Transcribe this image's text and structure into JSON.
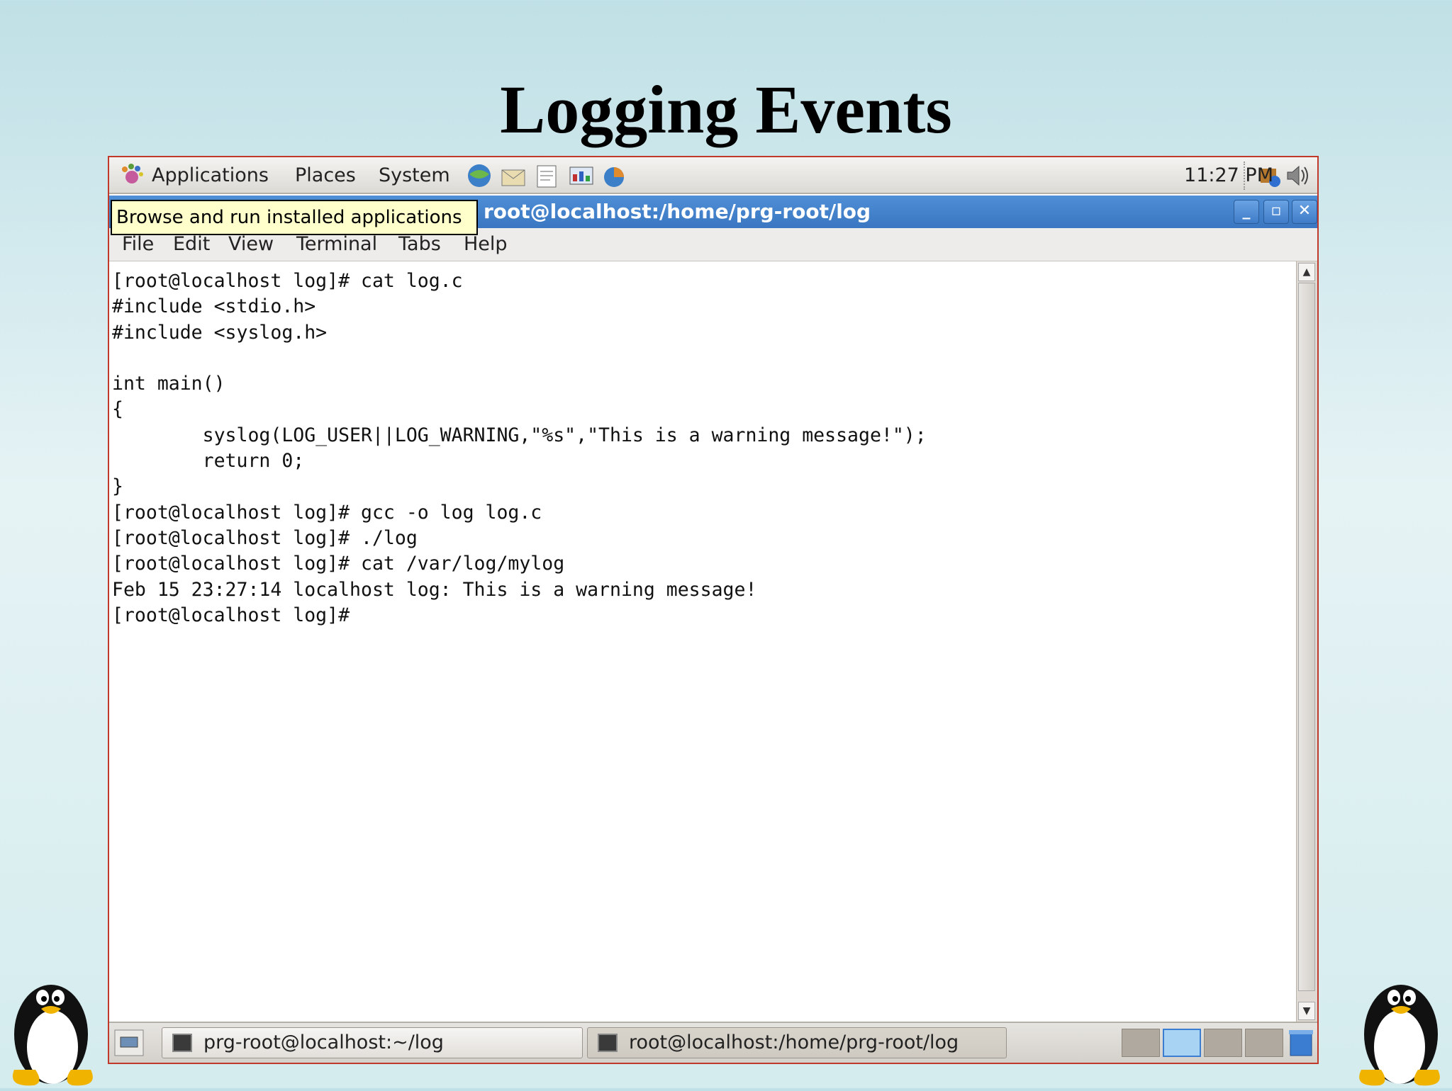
{
  "slide": {
    "title": "Logging Events"
  },
  "top_panel": {
    "menus": [
      "Applications",
      "Places",
      "System"
    ],
    "clock": "11:27 PM"
  },
  "window": {
    "title": "root@localhost:/home/prg-root/log",
    "tooltip": "Browse and run installed applications",
    "menubar": [
      "File",
      "Edit",
      "View",
      "Terminal",
      "Tabs",
      "Help"
    ]
  },
  "terminal": {
    "lines": [
      "[root@localhost log]# cat log.c",
      "#include <stdio.h>",
      "#include <syslog.h>",
      "",
      "int main()",
      "{",
      "        syslog(LOG_USER||LOG_WARNING,\"%s\",\"This is a warning message!\");",
      "        return 0;",
      "}",
      "[root@localhost log]# gcc -o log log.c",
      "[root@localhost log]# ./log",
      "[root@localhost log]# cat /var/log/mylog",
      "Feb 15 23:27:14 localhost log: This is a warning message!",
      "[root@localhost log]# "
    ]
  },
  "taskbar": {
    "tasks": [
      "prg-root@localhost:~/log",
      "root@localhost:/home/prg-root/log"
    ]
  }
}
